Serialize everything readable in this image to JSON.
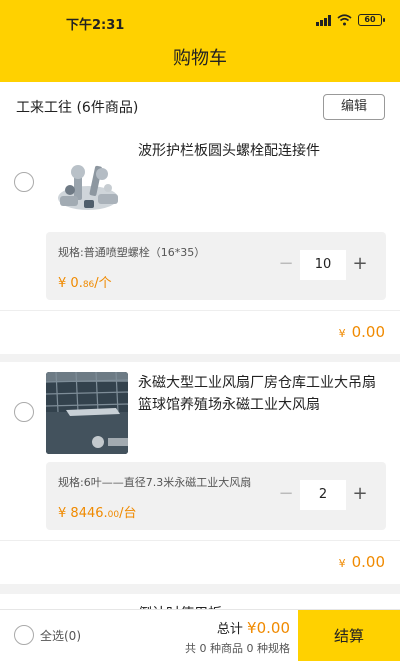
{
  "status": {
    "time": "下午2:31",
    "battery": "60"
  },
  "header": {
    "title": "购物车"
  },
  "shop": {
    "name": "工来工往 (6件商品)",
    "edit_label": "编辑"
  },
  "items": [
    {
      "name": "波形护栏板圆头螺栓配连接件",
      "spec": "规格:普通喷塑螺栓（16*35）",
      "price_symbol": "¥",
      "price_int": "0.",
      "price_dec": "86",
      "price_unit": "/个",
      "quantity": "10",
      "subtotal_symbol": "¥",
      "subtotal": "0.00"
    },
    {
      "name": "永磁大型工业风扇厂房仓库工业大吊扇篮球馆养殖场永磁工业大风扇",
      "spec": "规格:6叶——直径7.3米永磁工业大风扇",
      "price_symbol": "¥",
      "price_int": "8446.",
      "price_dec": "00",
      "price_unit": "/台",
      "quantity": "2",
      "subtotal_symbol": "¥",
      "subtotal": "0.00"
    }
  ],
  "next_item_partial": "倒计时使用板",
  "footer": {
    "select_all": "全选(0)",
    "total_label": "总计",
    "total_amount": "¥0.00",
    "count_text": "共 0 种商品 0 种规格",
    "checkout_label": "结算"
  },
  "colors": {
    "brand": "#ffd100",
    "price": "#f08a00"
  },
  "icons": {
    "stepper_minus": "minus-icon",
    "stepper_plus": "plus-icon"
  }
}
